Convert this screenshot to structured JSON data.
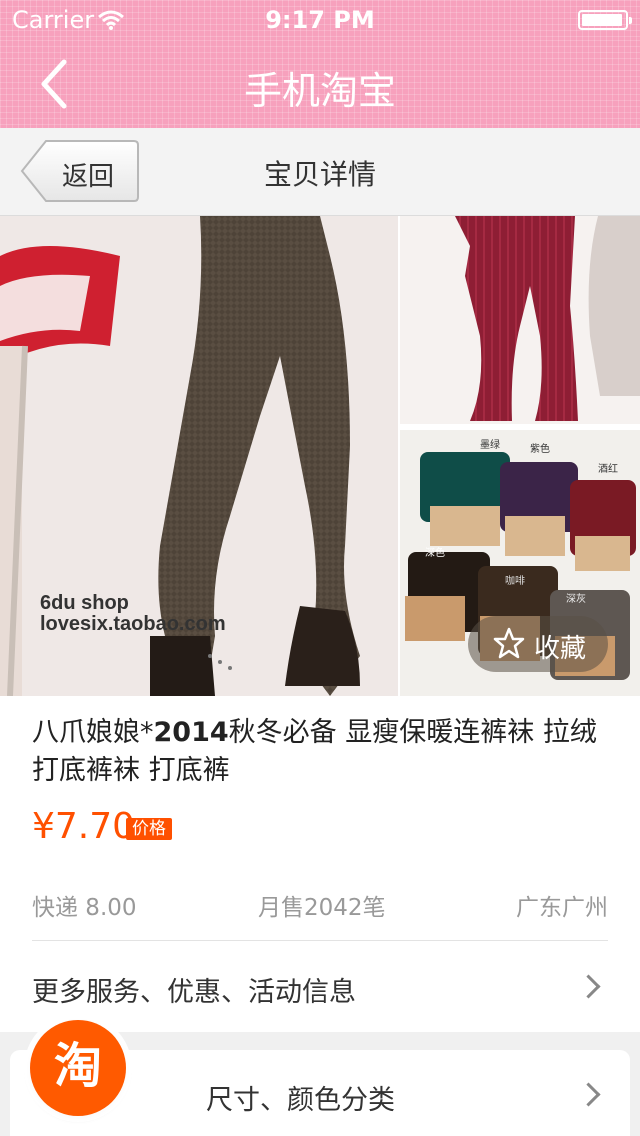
{
  "status_bar": {
    "carrier": "Carrier",
    "time": "9:17 PM",
    "battery_level": 0.95
  },
  "nav": {
    "title": "手机淘宝",
    "back_icon": "chevron-left-icon"
  },
  "subnav": {
    "back_label": "返回",
    "title": "宝贝详情"
  },
  "gallery": {
    "watermark_line1": "6du shop",
    "watermark_line2": "lovesix.taobao.com",
    "swatch_labels": [
      "墨绿",
      "紫色",
      "酒红",
      "深色",
      "咖啡",
      "深灰"
    ],
    "favorite_label": "收藏",
    "favorite_icon": "star-outline-icon"
  },
  "product": {
    "title_prefix": "八爪娘娘*",
    "title_bold": "2014",
    "title_rest": "秋冬必备 显瘦保暖连裤袜 拉绒打底裤袜 打底裤",
    "price": "¥7.70",
    "price_tag": "价格",
    "shipping": "快递 8.00",
    "monthly_sales": "月售2042笔",
    "location": "广东广州"
  },
  "rows": {
    "services": "更多服务、优惠、活动信息",
    "options_visible": "尺寸、颜色分类"
  },
  "floating_badge": {
    "icon": "taobao-logo-icon",
    "glyph": "淘"
  },
  "colors": {
    "nav_pink": "#f7a1bd",
    "price_orange": "#ff5000",
    "badge_orange": "#ff5a00"
  }
}
